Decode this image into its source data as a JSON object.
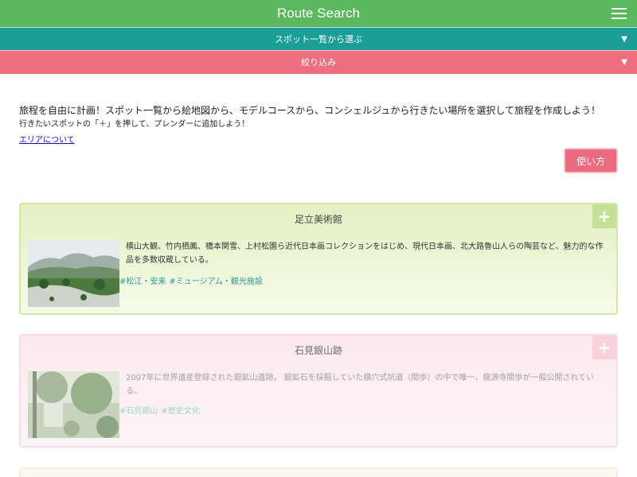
{
  "header": {
    "title": "Route Search",
    "menu_icon": "hamburger-menu-icon"
  },
  "spot_list_bar": {
    "label": "スポット一覧から選ぶ",
    "arrow": "▼"
  },
  "filter_bar": {
    "label": "絞り込み",
    "arrow": "▼"
  },
  "intro": {
    "line1": "旅程を自由に計画！スポット一覧から絵地図から、モデルコースから、コンシェルジュから行きたい場所を選択して旅程を作成しよう！",
    "line2": "行きたいスポットの「＋」を押して、プレンダーに追加しよう！",
    "area_link": "エリアについて"
  },
  "howto_button": {
    "label": "使い方"
  },
  "spots": [
    {
      "name": "足立美術館",
      "plus": "+",
      "description": "横山大観、竹内栖鳳、橋本関雪、上村松園ら近代日本画コレクションをはじめ、現代日本画、北大路魯山人らの陶芸など、魅力的な作品を多数収蔵している。",
      "tags": [
        "#松江・安来",
        "#ミュージアム・観光施設"
      ]
    },
    {
      "name": "石見銀山跡",
      "plus": "+",
      "description": "2007年に世界遺産登録された銀鉱山遺跡。 銀鉱石を採掘していた横穴式坑道（間歩）の中で唯一、龍源寺間歩が一般公開されている。",
      "tags": [
        "#石見銀山",
        "#歴史文化"
      ]
    }
  ],
  "colors": {
    "header": "#5cb85c",
    "spot_list_bar": "#1a9e96",
    "filter_bar": "#ee6e7f",
    "howto_button": "#ea6a7e",
    "tag": "#2aa198"
  }
}
